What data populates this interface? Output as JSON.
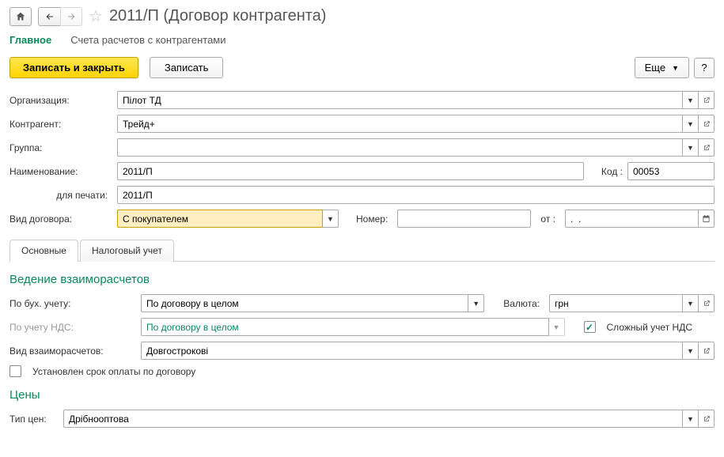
{
  "header": {
    "title": "2011/П (Договор контрагента)"
  },
  "topTabs": {
    "main": "Главное",
    "accounts": "Счета расчетов с контрагентами"
  },
  "actions": {
    "saveClose": "Записать и закрыть",
    "save": "Записать",
    "more": "Еще",
    "help": "?"
  },
  "labels": {
    "org": "Организация:",
    "counterparty": "Контрагент:",
    "group": "Группа:",
    "name": "Наименование:",
    "code": "Код :",
    "forPrint": "для печати:",
    "contractType": "Вид договора:",
    "number": "Номер:",
    "from": "от   :",
    "datePlaceholder": ".  .",
    "byAccounting": "По бух. учету:",
    "byVat": "По учету НДС:",
    "currency": "Валюта:",
    "complexVat": "Сложный  учет НДС",
    "settlementType": "Вид взаиморасчетов:",
    "paymentTerm": "Установлен срок оплаты по договору",
    "priceType": "Тип цен:"
  },
  "values": {
    "org": "Пілот ТД",
    "counterparty": "Трейд+",
    "group": "",
    "name": "2011/П",
    "code": "00053",
    "forPrint": "2011/П",
    "contractType": "С покупателем",
    "number": "",
    "byAccounting": "По договору в целом",
    "byVat": "По договору в целом",
    "currency": "грн",
    "settlementType": "Довгострокові",
    "priceType": "Дрібнооптова"
  },
  "midTabs": {
    "main": "Основные",
    "tax": "Налоговый учет"
  },
  "sections": {
    "settlements": "Ведение взаиморасчетов",
    "prices": "Цены"
  }
}
